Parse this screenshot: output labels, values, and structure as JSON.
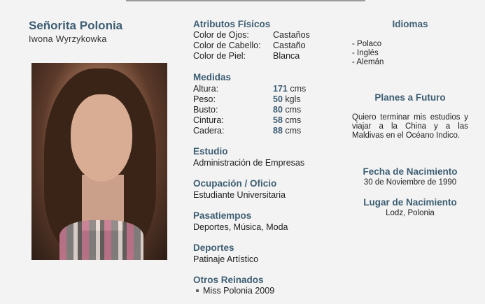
{
  "profile": {
    "title": "Señorita Polonia",
    "name": "Iwona Wyrzykowka"
  },
  "physical": {
    "heading": "Atributos Físicos",
    "rows": [
      {
        "label": "Color de Ojos:",
        "value": "Castaños"
      },
      {
        "label": "Color de Cabello:",
        "value": "Castaño"
      },
      {
        "label": "Color de Piel:",
        "value": "Blanca"
      }
    ]
  },
  "measures": {
    "heading": "Medidas",
    "rows": [
      {
        "label": "Altura:",
        "value": "171",
        "unit": "cms"
      },
      {
        "label": "Peso:",
        "value": "50",
        "unit": "kgls"
      },
      {
        "label": "Busto:",
        "value": "80",
        "unit": "cms"
      },
      {
        "label": "Cintura:",
        "value": "58",
        "unit": "cms"
      },
      {
        "label": "Cadera:",
        "value": "88",
        "unit": "cms"
      }
    ]
  },
  "study": {
    "heading": "Estudio",
    "value": "Administración de Empresas"
  },
  "occupation": {
    "heading": "Ocupación / Oficio",
    "value": "Estudiante Universitaria"
  },
  "hobbies": {
    "heading": "Pasatiempos",
    "value": "Deportes, Música, Moda"
  },
  "sports": {
    "heading": "Deportes",
    "value": "Patinaje Artístico"
  },
  "reigns": {
    "heading": "Otros Reinados",
    "items": [
      "Miss Polonia 2009"
    ]
  },
  "languages": {
    "heading": "Idiomas",
    "items": [
      "- Polaco",
      "- Inglés",
      "- Alemán"
    ]
  },
  "plans": {
    "heading": "Planes a Futuro",
    "text": "Quiero terminar mis estudios y viajar a la China y a las Maldivas en el Océano Indico."
  },
  "birthdate": {
    "heading": "Fecha de Nacimiento",
    "value": "30 de Noviembre de 1990"
  },
  "birthplace": {
    "heading": "Lugar de Nacimiento",
    "value": "Lodz, Polonia"
  },
  "colors": {
    "accent": "#3d5e73",
    "background": "#f3f3f3"
  }
}
